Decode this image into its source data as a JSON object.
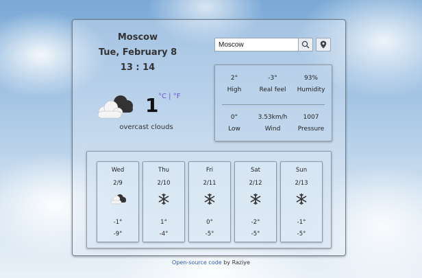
{
  "current": {
    "city": "Moscow",
    "date": "Tue, February 8",
    "time": "13 : 14",
    "temperature": "1",
    "unit_c": "°C",
    "unit_sep": " | ",
    "unit_f": "°F",
    "description": "overcast clouds",
    "icon": "overcast-clouds-icon"
  },
  "search": {
    "value": "Moscow",
    "placeholder": "",
    "search_icon": "search-icon",
    "location_icon": "location-pin-icon"
  },
  "details": {
    "high": {
      "value": "2°",
      "label": "High"
    },
    "real_feel": {
      "value": "-3°",
      "label": "Real feel"
    },
    "humidity": {
      "value": "93%",
      "label": "Humidity"
    },
    "low": {
      "value": "0°",
      "label": "Low"
    },
    "wind": {
      "value": "3.53km/h",
      "label": "Wind"
    },
    "pressure": {
      "value": "1007",
      "label": "Pressure"
    }
  },
  "forecast": [
    {
      "day": "Wed",
      "date": "2/9",
      "icon": "overcast-clouds-icon",
      "high": "-1°",
      "low": "-9°"
    },
    {
      "day": "Thu",
      "date": "2/10",
      "icon": "snowflake-icon",
      "high": "1°",
      "low": "-4°"
    },
    {
      "day": "Fri",
      "date": "2/11",
      "icon": "snowflake-icon",
      "high": "0°",
      "low": "-5°"
    },
    {
      "day": "Sat",
      "date": "2/12",
      "icon": "snowflake-icon",
      "high": "-2°",
      "low": "-5°"
    },
    {
      "day": "Sun",
      "date": "2/13",
      "icon": "snowflake-icon",
      "high": "-1°",
      "low": "-5°"
    }
  ],
  "footer": {
    "link": "Open-source code",
    "text": " by Raziye"
  },
  "colors": {
    "unit_accent": "#6b4fd8",
    "link": "#2a5db0"
  }
}
